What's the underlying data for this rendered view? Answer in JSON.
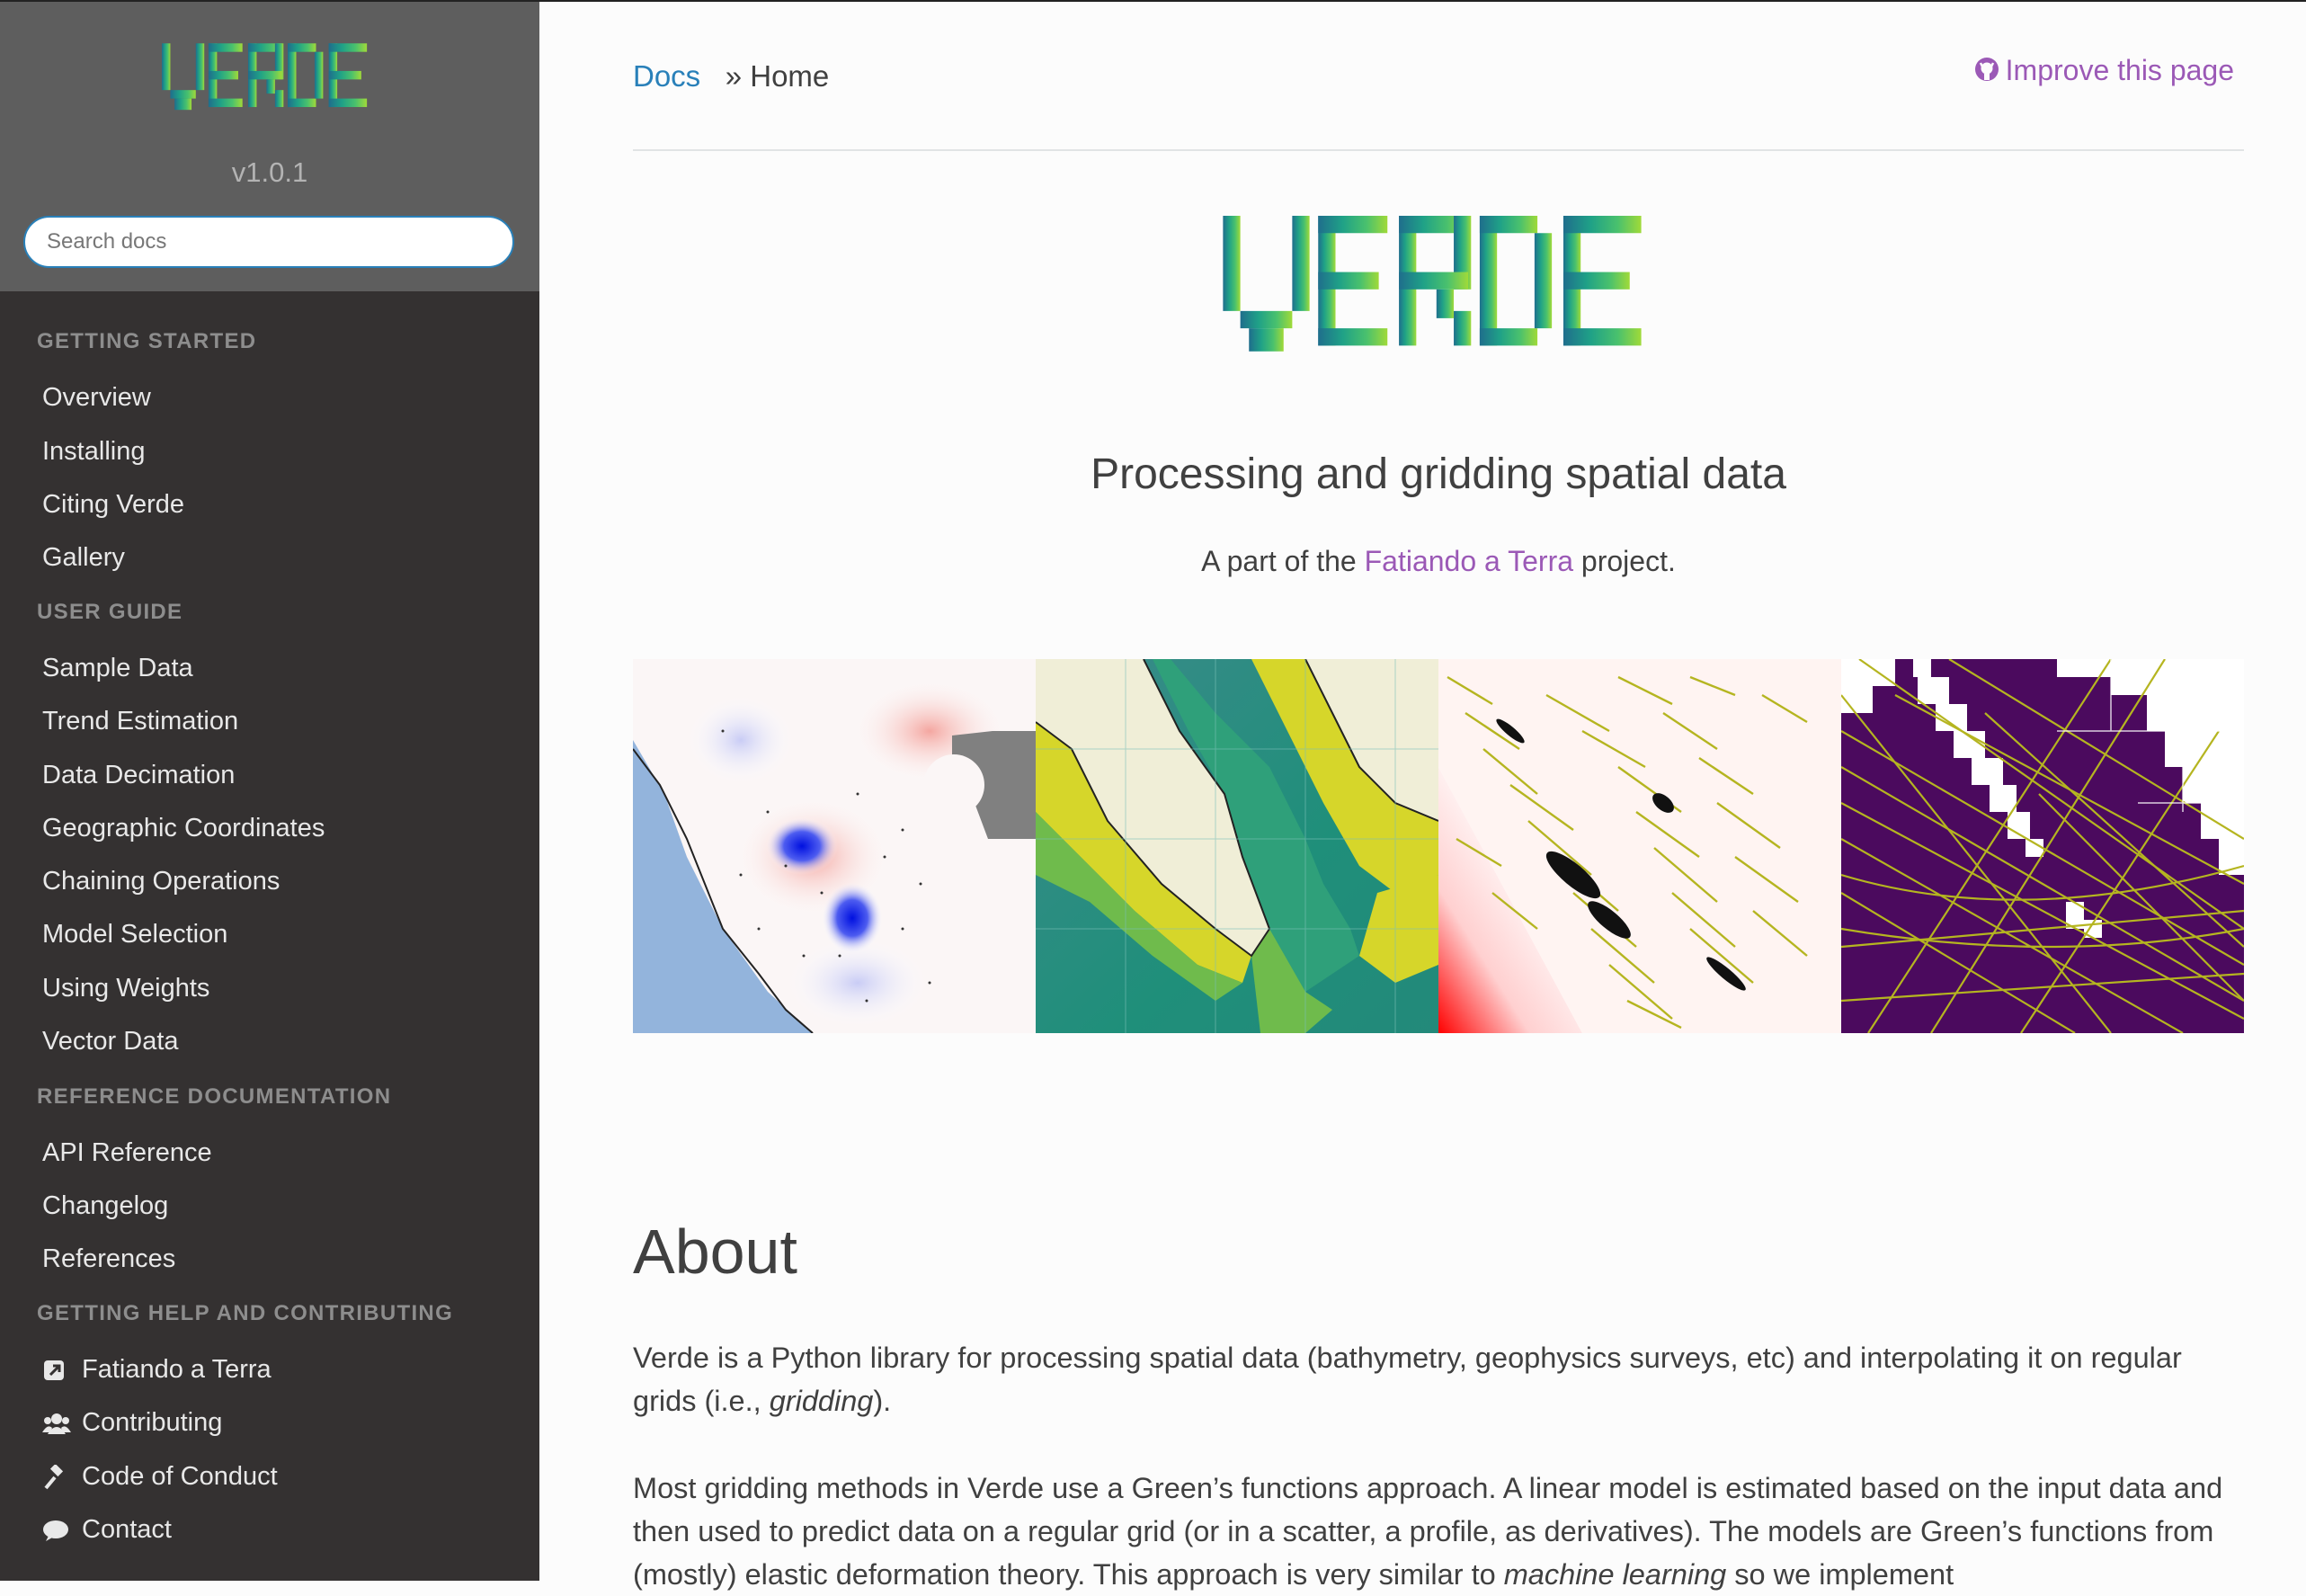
{
  "sidebar": {
    "logo_text": "VERDE",
    "version": "v1.0.1",
    "search_placeholder": "Search docs",
    "sections": [
      {
        "caption": "GETTING STARTED",
        "items": [
          "Overview",
          "Installing",
          "Citing Verde",
          "Gallery"
        ]
      },
      {
        "caption": "USER GUIDE",
        "items": [
          "Sample Data",
          "Trend Estimation",
          "Data Decimation",
          "Geographic Coordinates",
          "Chaining Operations",
          "Model Selection",
          "Using Weights",
          "Vector Data"
        ]
      },
      {
        "caption": "REFERENCE DOCUMENTATION",
        "items": [
          "API Reference",
          "Changelog",
          "References"
        ]
      },
      {
        "caption": "GETTING HELP AND CONTRIBUTING",
        "items": [
          {
            "label": "Fatiando a Terra",
            "icon": "external-link-icon"
          },
          {
            "label": "Contributing",
            "icon": "users-icon"
          },
          {
            "label": "Code of Conduct",
            "icon": "gavel-icon"
          },
          {
            "label": "Contact",
            "icon": "comment-icon"
          }
        ]
      }
    ]
  },
  "breadcrumb": {
    "docs": "Docs",
    "separator": "»",
    "current": "Home"
  },
  "improve_link": "Improve this page",
  "main": {
    "logo_text": "VERDE",
    "tagline": "Processing and gridding spatial data",
    "partof_pre": "A part of the",
    "partof_link": "Fatiando a Terra",
    "partof_post": "project.",
    "about_title": "About",
    "para1_a": "Verde is a Python library for processing spatial data (bathymetry, geophysics surveys, etc) and interpolating it on regular grids (i.e., ",
    "para1_em": "gridding",
    "para1_b": ").",
    "para2_a": "Most gridding methods in Verde use a Green’s functions approach. A linear model is estimated based on the input data and then used to predict data on a regular grid (or in a scatter, a profile, as derivatives). The models are Green’s functions from (mostly) elastic deformation theory. This approach is very similar to ",
    "para2_em": "machine learning",
    "para2_b": " so we implement"
  },
  "colors": {
    "sidebar_bg": "#343131",
    "sidebar_top_bg": "#5e5e5e",
    "link_blue": "#2980b9",
    "link_purple": "#9b59b6",
    "text": "#404040",
    "logo_gradient": [
      "#1f6e8c",
      "#1fa187",
      "#4ac16d",
      "#a0da39"
    ]
  }
}
